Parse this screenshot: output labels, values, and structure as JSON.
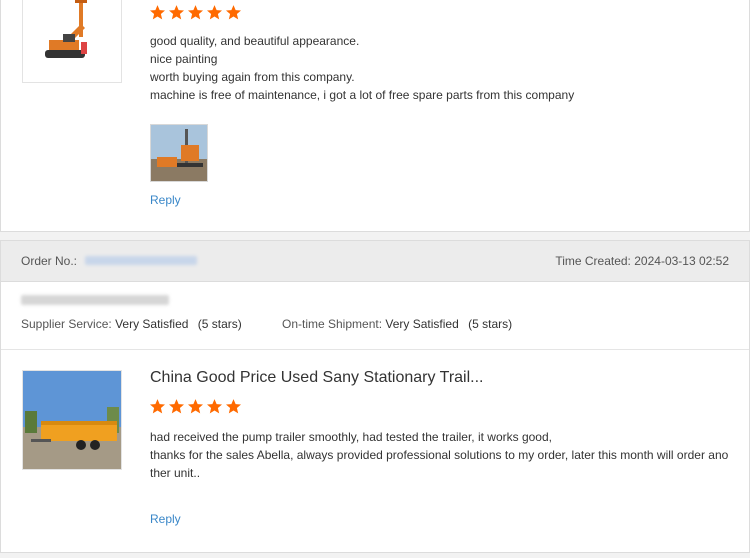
{
  "review1": {
    "product_image_icon": "drilling-rig-thumbnail",
    "rating": 5,
    "lines": [
      "good quality, and beautiful appearance.",
      "nice painting",
      "worth buying again from this company.",
      "machine is free of maintenance, i got a lot of free spare parts from this company"
    ],
    "photo_icon": "drilling-rig-photo",
    "reply_label": "Reply"
  },
  "review2": {
    "order_label": "Order No.:",
    "time_label": "Time Created:",
    "time_value": "2024-03-13 02:52",
    "supplier_service_label": "Supplier Service:",
    "supplier_service_value": "Very Satisfied",
    "supplier_service_stars": "(5 stars)",
    "shipment_label": "On-time Shipment:",
    "shipment_value": "Very Satisfied",
    "shipment_stars": "(5 stars)",
    "product_image_icon": "pump-trailer-thumbnail",
    "product_title": "China Good Price Used Sany Stationary Trail...",
    "rating": 5,
    "lines": [
      "had received the pump trailer smoothly, had tested the trailer, it works good,",
      "thanks for the sales Abella, always provided professional solutions to my order, later this month will order ano",
      "ther unit.."
    ],
    "reply_label": "Reply"
  },
  "colors": {
    "star": "#ff6a00",
    "link": "#3a87c8",
    "header_bg": "#ececec"
  }
}
